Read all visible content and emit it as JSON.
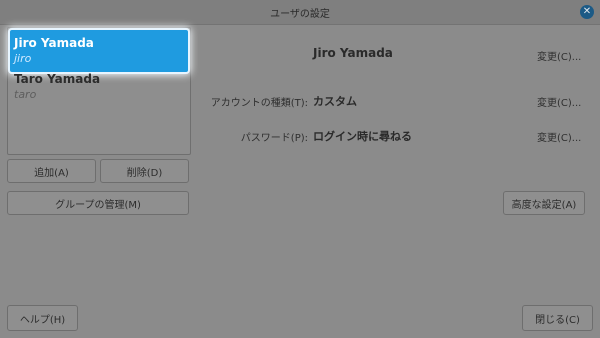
{
  "window": {
    "title": "ユーザの設定",
    "close_glyph": "✕"
  },
  "users": [
    {
      "name": "Jiro Yamada",
      "login": "jiro",
      "selected": true
    },
    {
      "name": "Taro Yamada",
      "login": "taro",
      "selected": false
    }
  ],
  "list_buttons": {
    "add": "追加(A)",
    "remove": "削除(D)",
    "manage_groups": "グループの管理(M)"
  },
  "details": {
    "full_name": "Jiro Yamada",
    "account_type_label": "アカウントの種類(T):",
    "account_type_value": "カスタム",
    "password_label": "パスワード(P):",
    "password_value": "ログイン時に尋ねる",
    "change_label": "変更(C)...",
    "advanced_label": "高度な設定(A)"
  },
  "footer": {
    "help": "ヘルプ(H)",
    "close": "閉じる(C)"
  },
  "colors": {
    "accent": "#1f9be0",
    "window_bg": "#8b8b8b",
    "close_button": "#1c5a86"
  },
  "icons": {
    "close": "close-icon"
  }
}
